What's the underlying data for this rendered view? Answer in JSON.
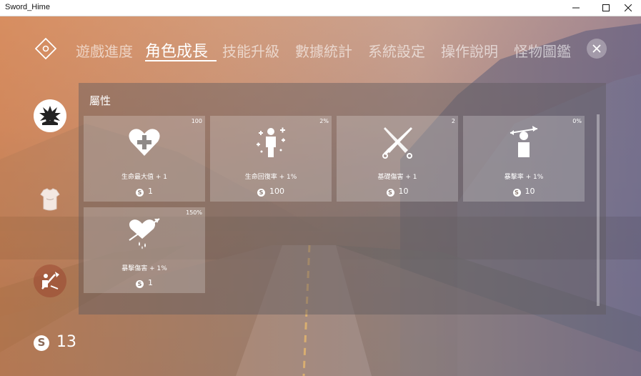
{
  "window": {
    "title": "Sword_Hime"
  },
  "tabs": [
    {
      "label": "遊戲進度"
    },
    {
      "label": "角色成長",
      "active": true
    },
    {
      "label": "技能升級"
    },
    {
      "label": "數據統計"
    },
    {
      "label": "系統設定"
    },
    {
      "label": "操作說明"
    },
    {
      "label": "怪物圖鑑"
    }
  ],
  "side_nav": [
    {
      "icon": "explosion-icon",
      "active": true
    },
    {
      "icon": "armor-icon"
    },
    {
      "icon": "swords-icon"
    }
  ],
  "coins": {
    "icon": "coin-icon",
    "symbol": "S",
    "count": "13"
  },
  "panel": {
    "title": "屬性",
    "cards": [
      {
        "icon": "heart-plus-icon",
        "level": "100",
        "label": "生命最大值 + 1",
        "cost": "1"
      },
      {
        "icon": "person-sparkle-icon",
        "level": "2%",
        "label": "生命回復率 + 1%",
        "cost": "100"
      },
      {
        "icon": "crossed-swords-icon",
        "level": "2",
        "label": "基礎傷害 + 1",
        "cost": "10"
      },
      {
        "icon": "arrow-head-icon",
        "level": "0%",
        "label": "暴擊率 + 1%",
        "cost": "10"
      },
      {
        "icon": "pierced-heart-icon",
        "level": "150%",
        "label": "暴擊傷害 + 1%",
        "cost": "1"
      }
    ]
  },
  "colors": {
    "accent": "#ffffff",
    "panel_bg": "rgba(95,90,95,0.45)",
    "warm_tint": "#d7783c",
    "cool_tint": "#5a5a96"
  }
}
